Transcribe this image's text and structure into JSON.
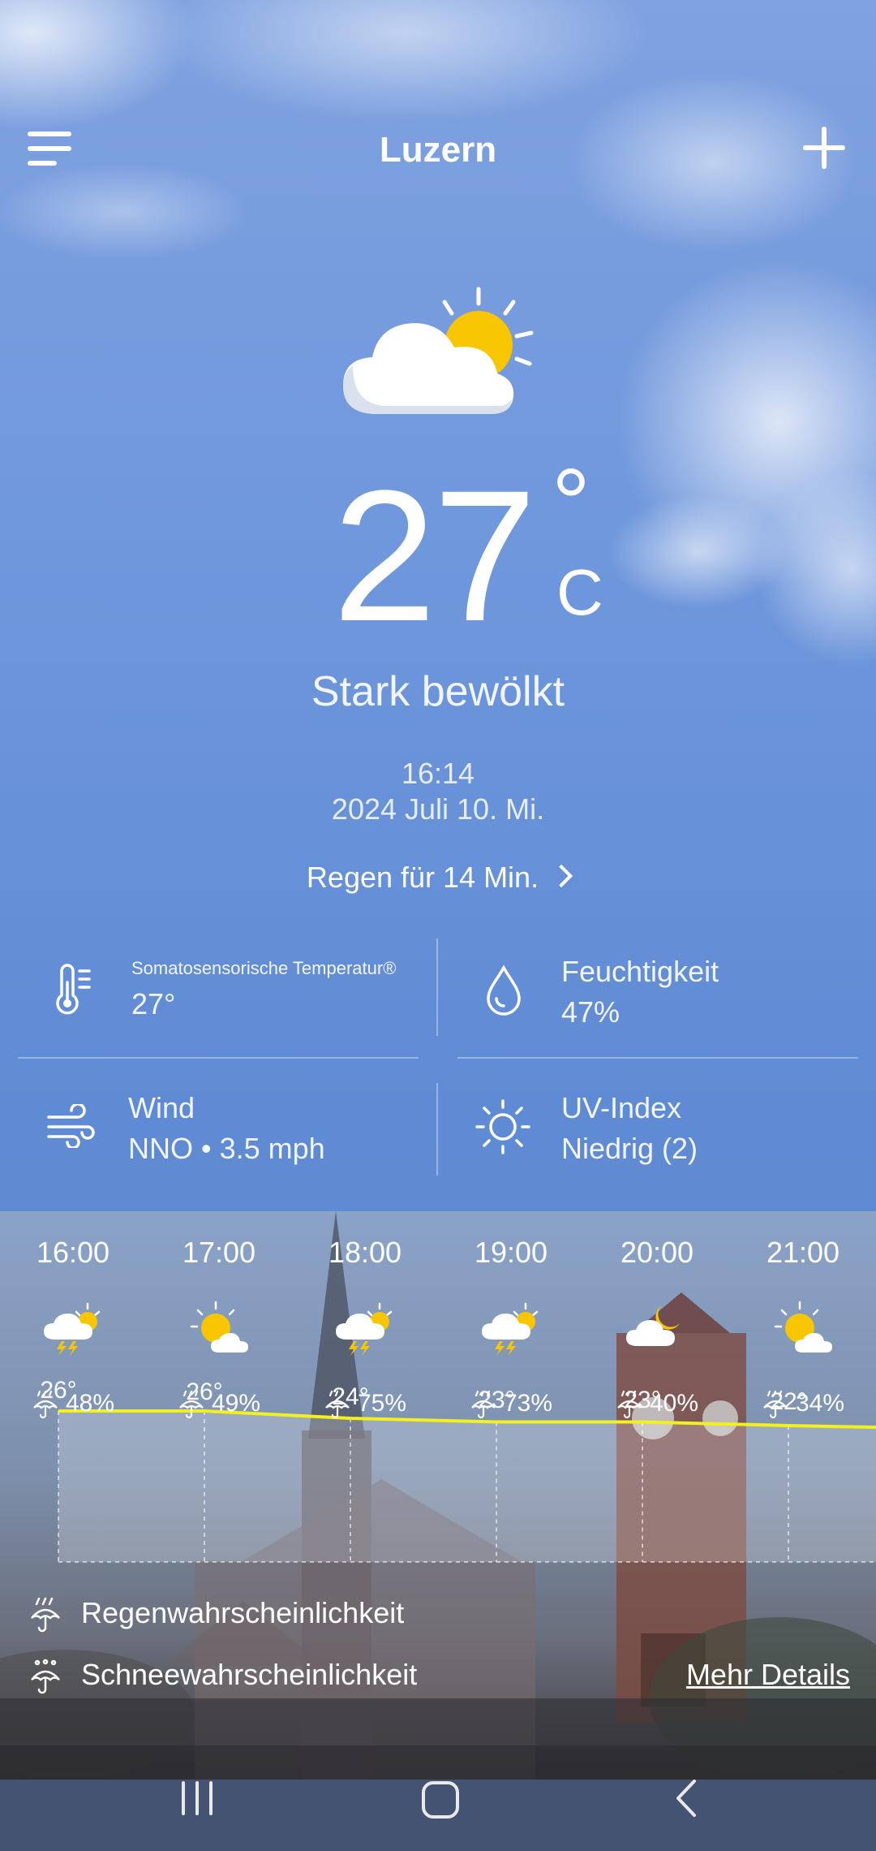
{
  "header": {
    "city": "Luzern"
  },
  "current": {
    "temperature": "27",
    "degree_symbol": "°",
    "unit": "C",
    "condition": "Stark bewölkt",
    "time": "16:14",
    "date": "2024 Juli 10. Mi.",
    "rain_notice": "Regen für 14 Min.",
    "icon": "partly-cloudy-icon"
  },
  "details": {
    "feels_like_label": "Somatosensorische Temperatur®",
    "feels_like_value": "27°",
    "humidity_label": "Feuchtigkeit",
    "humidity_value": "47%",
    "wind_label": "Wind",
    "wind_value": "NNO • 3.5 mph",
    "uv_label": "UV-Index",
    "uv_value": "Niedrig (2)"
  },
  "hourly": [
    {
      "time": "16:00",
      "precip": "48%",
      "temp": "26°",
      "icon": "thunder-sun-cloud-icon"
    },
    {
      "time": "17:00",
      "precip": "49%",
      "temp": "26°",
      "icon": "sun-cloud-icon"
    },
    {
      "time": "18:00",
      "precip": "75%",
      "temp": "24°",
      "icon": "thunder-sun-cloud-icon"
    },
    {
      "time": "19:00",
      "precip": "73%",
      "temp": "23°",
      "icon": "thunder-sun-cloud-icon"
    },
    {
      "time": "20:00",
      "precip": "40%",
      "temp": "23°",
      "icon": "cloud-moon-icon"
    },
    {
      "time": "21:00",
      "precip": "34%",
      "temp": "22°",
      "icon": "sun-cloud-icon"
    }
  ],
  "legend": {
    "rain": "Regenwahrscheinlichkeit",
    "snow": "Schneewahrscheinlichkeit",
    "more_details": "Mehr Details"
  },
  "colors": {
    "accent_line": "#f2f21a",
    "sun": "#f7c600"
  }
}
